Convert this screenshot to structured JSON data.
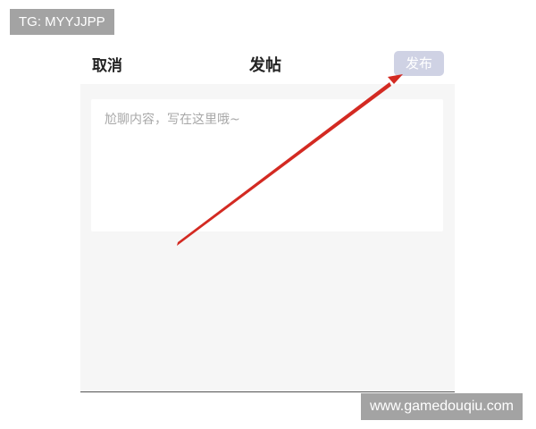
{
  "watermarks": {
    "top_left": "TG: MYYJJPP",
    "bottom_right": "www.gamedouqiu.com"
  },
  "header": {
    "cancel_label": "取消",
    "title": "发帖",
    "publish_label": "发布"
  },
  "editor": {
    "value": "",
    "placeholder": "尬聊内容，写在这里哦~"
  },
  "colors": {
    "publish_button_bg": "#cfd2e4",
    "annotation_arrow": "#d32a22",
    "panel_bg": "#f6f6f6"
  }
}
